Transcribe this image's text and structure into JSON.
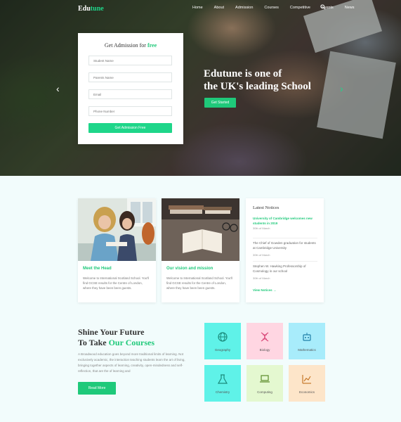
{
  "brand": {
    "logo_main": "Edu",
    "logo_accent": "tune"
  },
  "nav": {
    "items": [
      "Home",
      "About",
      "Admission",
      "Courses",
      "Competitive",
      "Events",
      "News"
    ]
  },
  "hero": {
    "headline_line1": "Edutune is one of",
    "headline_line2": "the UK's leading School",
    "button": "Get Started"
  },
  "admission_form": {
    "title_main": "Get Admission for",
    "title_accent": "free",
    "fields": [
      {
        "placeholder": "Student Name"
      },
      {
        "placeholder": "Parents Name"
      },
      {
        "placeholder": "Email"
      },
      {
        "placeholder": "Phone Number"
      }
    ],
    "submit": "Get Admission Free"
  },
  "cards": [
    {
      "title": "Meet the Head",
      "text": "Welcome to International Scotland School. You'll find GCSE results for the Centre of London, where they have been been guests."
    },
    {
      "title": "Our vision and mission",
      "text": "Welcome to International Scotland School. You'll find GCSE results for the Centre of London, where they have been been guests."
    }
  ],
  "notices": {
    "heading": "Latest Notices",
    "items": [
      {
        "text": "University of Cambridge welcomes new students in 2019",
        "meta": "30th of March"
      },
      {
        "text": "The Chief of Gowden graduation for students at Cambridge University",
        "meta": "30th of March"
      },
      {
        "text": "Stephen W. Hawking Professorship of Cosmology in our school",
        "meta": "30th of March"
      }
    ],
    "more": "View Notices"
  },
  "shine": {
    "line1": "Shine Your Future",
    "line2_main": "To Take",
    "line2_accent": "Our Courses",
    "desc": "A Broadwood education goes beyond more traditional limits of learning. Not exclusively academic, the interaction teaching students learn the art of living, bringing together aspects of learning, creativity, open-mindedness and self-reflection, that are the of learning and",
    "button": "Read More"
  },
  "courses": [
    {
      "label": "Geography",
      "bg": "#5ff2e8",
      "icon": "globe-icon"
    },
    {
      "label": "Biology",
      "bg": "#ffd6e2",
      "icon": "dna-icon"
    },
    {
      "label": "Mathematics",
      "bg": "#a8ecfb",
      "icon": "robot-icon"
    },
    {
      "label": "Chemistry",
      "bg": "#5ff2e8",
      "icon": "flask-icon"
    },
    {
      "label": "Computing",
      "bg": "#e4f8d0",
      "icon": "laptop-icon"
    },
    {
      "label": "Economics",
      "bg": "#fde5c9",
      "icon": "chart-icon"
    }
  ],
  "colors": {
    "accent": "#1fc97a",
    "page_bg": "#f2fcfc"
  }
}
